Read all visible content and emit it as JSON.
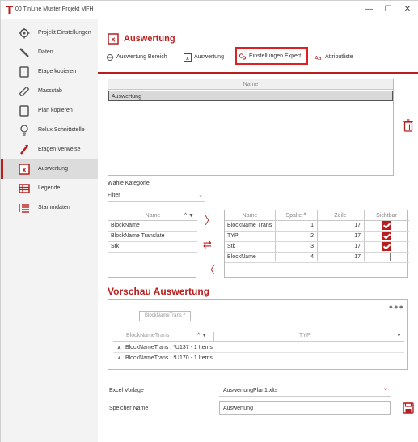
{
  "window": {
    "title": "00 TinLine Muster Projekt MFH",
    "minimize": "—",
    "maximize": "☐",
    "close": "✕",
    "accent": "#b81e1e"
  },
  "sidebar": {
    "items": [
      {
        "label": "Projekt Einstellungen",
        "icon": "gear-icon"
      },
      {
        "label": "Daten",
        "icon": "pencil-icon"
      },
      {
        "label": "Etage kopieren",
        "icon": "copy-icon"
      },
      {
        "label": "Massstab",
        "icon": "ruler-icon"
      },
      {
        "label": "Plan kopieren",
        "icon": "copy-icon"
      },
      {
        "label": "Relux Schnittstelle",
        "icon": "bulb-icon"
      },
      {
        "label": "Etagen Verweise",
        "icon": "arrow-icon"
      },
      {
        "label": "Auswertung",
        "icon": "excel-icon",
        "active": true
      },
      {
        "label": "Legende",
        "icon": "table-icon"
      },
      {
        "label": "Stammdaten",
        "icon": "list-icon"
      }
    ]
  },
  "main": {
    "title": "Auswertung",
    "tabs": [
      {
        "label": "Auswertung Bereich",
        "icon": "area-icon"
      },
      {
        "label": "Auswertung",
        "icon": "excel-icon"
      },
      {
        "label": "Einstellungen Expert",
        "icon": "settings-icon",
        "selected": true
      },
      {
        "label": "Attributliste",
        "icon": "attribute-icon"
      }
    ],
    "name_grid": {
      "header": "Name",
      "rows": [
        "Auswertung"
      ]
    },
    "category_label": "Wähle Kategorie",
    "filter_value": "Filter",
    "available_list": {
      "header": "Name",
      "items": [
        "BlockName",
        "BlockName Translate",
        "Stk"
      ]
    },
    "arrows": {
      "right": "〉",
      "swap": "⇄",
      "left": "〈"
    },
    "selected_list": {
      "headers": {
        "name": "Name",
        "spalte": "Spalte",
        "zeile": "Zeile",
        "sichtbar": "Sichtbar"
      },
      "rows": [
        {
          "name": "BlockName Trans",
          "spalte": "1",
          "zeile": "17",
          "sichtbar": true
        },
        {
          "name": "TYP",
          "spalte": "2",
          "zeile": "17",
          "sichtbar": true
        },
        {
          "name": "Stk",
          "spalte": "3",
          "zeile": "17",
          "sichtbar": true
        },
        {
          "name": "BlockName",
          "spalte": "4",
          "zeile": "17",
          "sichtbar": false
        }
      ]
    },
    "preview": {
      "title": "Vorschau Auswertung",
      "chip": "BlockNameTrans ^",
      "col1": "BlockNameTrans",
      "col2": "TYP",
      "groups": [
        "BlockNameTrans : *U137 - 1 Items",
        "BlockNameTrans : *U170 - 1 Items"
      ]
    },
    "excel_label": "Excel Vorlage",
    "excel_value": "AuswertungPlan1.xlts",
    "speicher_label": "Speicher Name",
    "speicher_value": "Auswertung"
  }
}
